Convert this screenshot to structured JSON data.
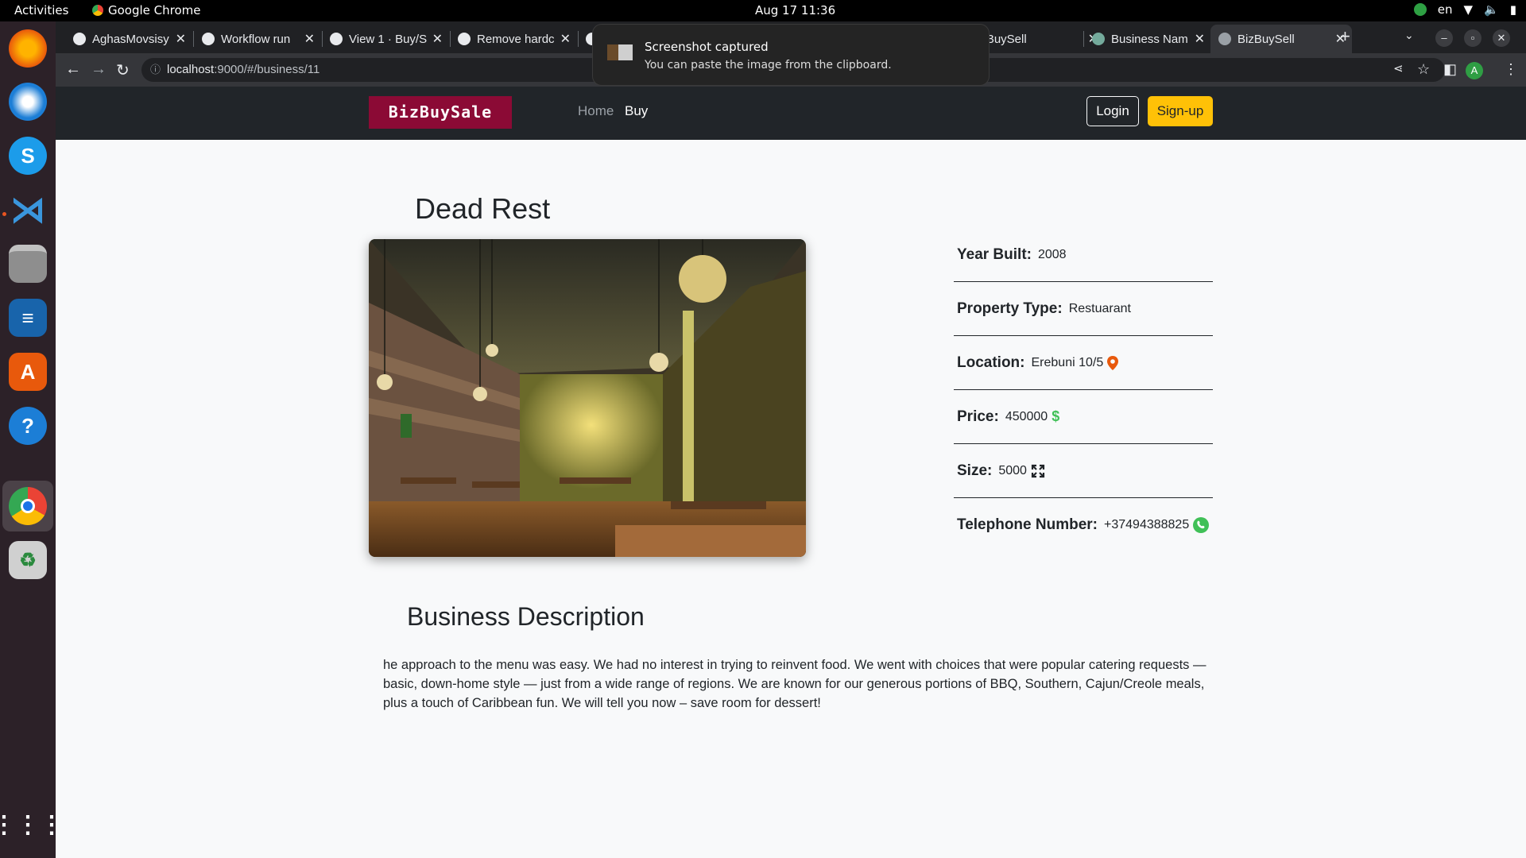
{
  "system": {
    "activities": "Activities",
    "app_name": "Google Chrome",
    "clock": "Aug 17  11:36",
    "language": "en"
  },
  "notification": {
    "title": "Screenshot captured",
    "body": "You can paste the image from the clipboard."
  },
  "browser": {
    "tabs": [
      {
        "title": "AghasMovsisy",
        "icon": "github-icon"
      },
      {
        "title": "Workflow run",
        "icon": "github-icon"
      },
      {
        "title": "View 1 · Buy/S",
        "icon": "github-icon"
      },
      {
        "title": "Remove hardc",
        "icon": "google-icon"
      },
      {
        "title": "",
        "icon": "google-icon"
      },
      {
        "title": "izBuySell",
        "icon": "globe-icon"
      },
      {
        "title": "Business Nam",
        "icon": "openai-icon"
      },
      {
        "title": "BizBuySell",
        "icon": "globe-icon"
      }
    ],
    "url_host": "localhost",
    "url_rest": ":9000/#/business/11"
  },
  "site": {
    "brand": "BizBuySale",
    "nav": {
      "home": "Home",
      "buy": "Buy"
    },
    "login": "Login",
    "signup": "Sign-up"
  },
  "business": {
    "name": "Dead Rest",
    "details": {
      "year_built": {
        "label": "Year Built:",
        "value": "2008"
      },
      "property_type": {
        "label": "Property Type:",
        "value": "Restuarant"
      },
      "location": {
        "label": "Location:",
        "value": "Erebuni 10/5"
      },
      "price": {
        "label": "Price:",
        "value": "450000"
      },
      "size": {
        "label": "Size:",
        "value": "5000"
      },
      "telephone": {
        "label": "Telephone Number:",
        "value": "+37494388825"
      }
    },
    "description_title": "Business Description",
    "description": "he approach to the menu was easy. We had no interest in trying to reinvent food. We went with choices that were popular catering requests — basic, down-home style — just from a wide range of regions. We are known for our generous portions of BBQ, Southern, Cajun/Creole meals, plus a touch of Caribbean fun. We will tell you now – save room for dessert!"
  },
  "colors": {
    "brand_bg": "#8b0a35",
    "signup_bg": "#ffc107",
    "navbar_bg": "#212529",
    "location_icon": "#e8590c",
    "price_icon": "#40c057",
    "phone_icon": "#40c057"
  }
}
